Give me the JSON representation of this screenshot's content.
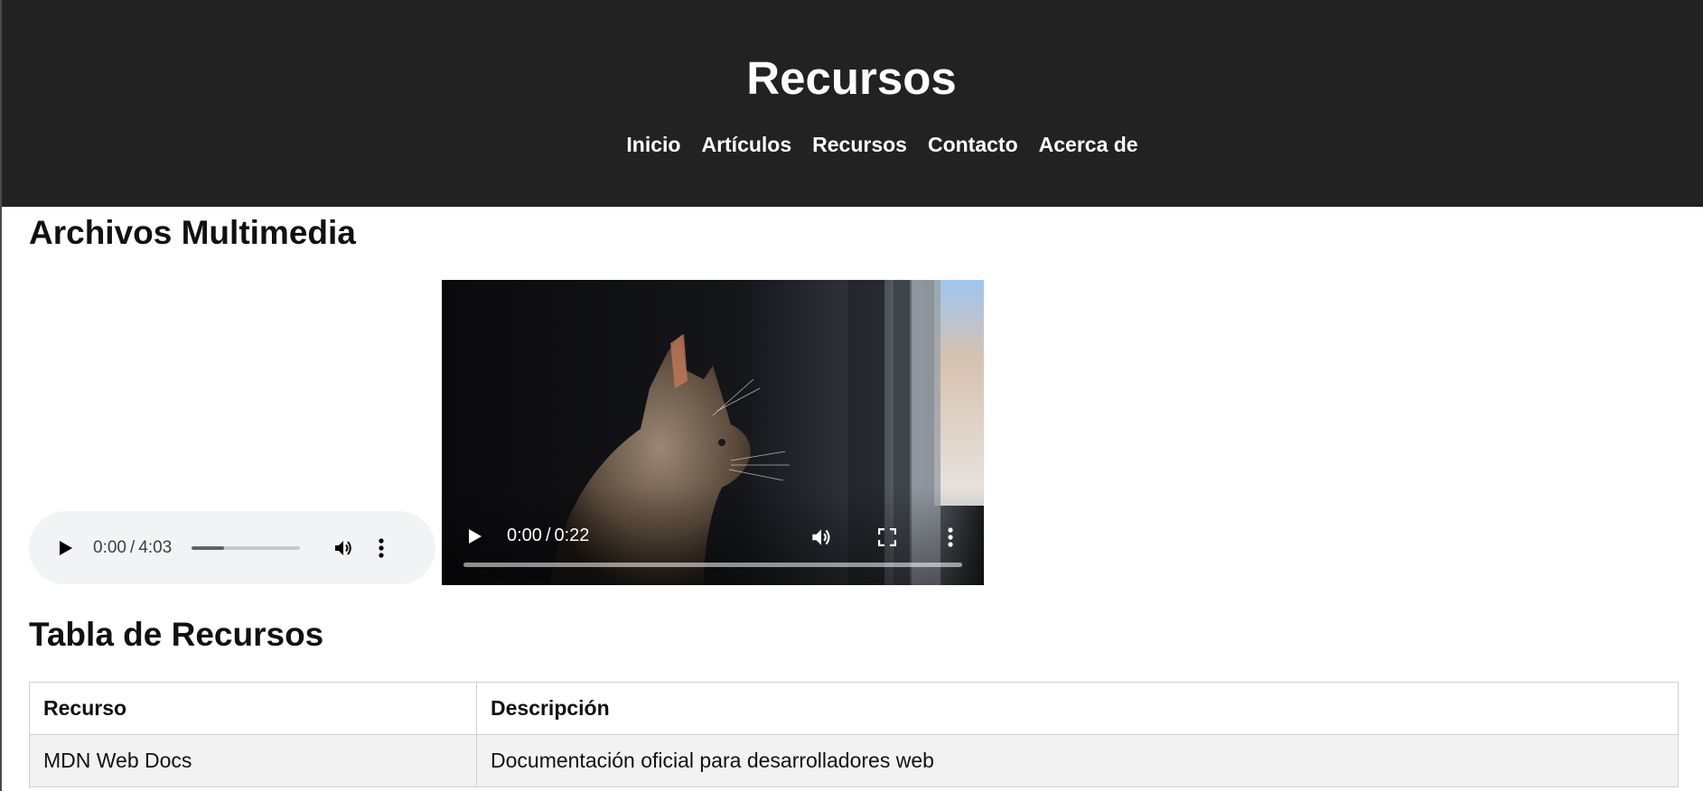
{
  "header": {
    "title": "Recursos",
    "nav": [
      "Inicio",
      "Artículos",
      "Recursos",
      "Contacto",
      "Acerca de"
    ]
  },
  "multimedia": {
    "heading": "Archivos Multimedia",
    "audio": {
      "current_time": "0:00",
      "separator": "/",
      "duration": "4:03",
      "buffered_fraction": 0.3
    },
    "video": {
      "current_time": "0:00",
      "separator": "/",
      "duration": "0:22",
      "played_fraction": 0.0
    }
  },
  "resources_table": {
    "heading": "Tabla de Recursos",
    "columns": [
      "Recurso",
      "Descripción"
    ],
    "rows": [
      [
        "MDN Web Docs",
        "Documentación oficial para desarrolladores web"
      ]
    ]
  },
  "colors": {
    "header_bg": "#222222",
    "header_text": "#ffffff",
    "audio_bg": "#f1f3f4",
    "row_stripe": "#f2f2f2"
  },
  "icons": {
    "audio_play": "play-icon",
    "audio_volume": "volume-icon",
    "audio_more": "more-vertical-icon",
    "video_play": "play-icon",
    "video_volume": "volume-icon",
    "video_fullscreen": "fullscreen-icon",
    "video_more": "more-vertical-icon"
  }
}
